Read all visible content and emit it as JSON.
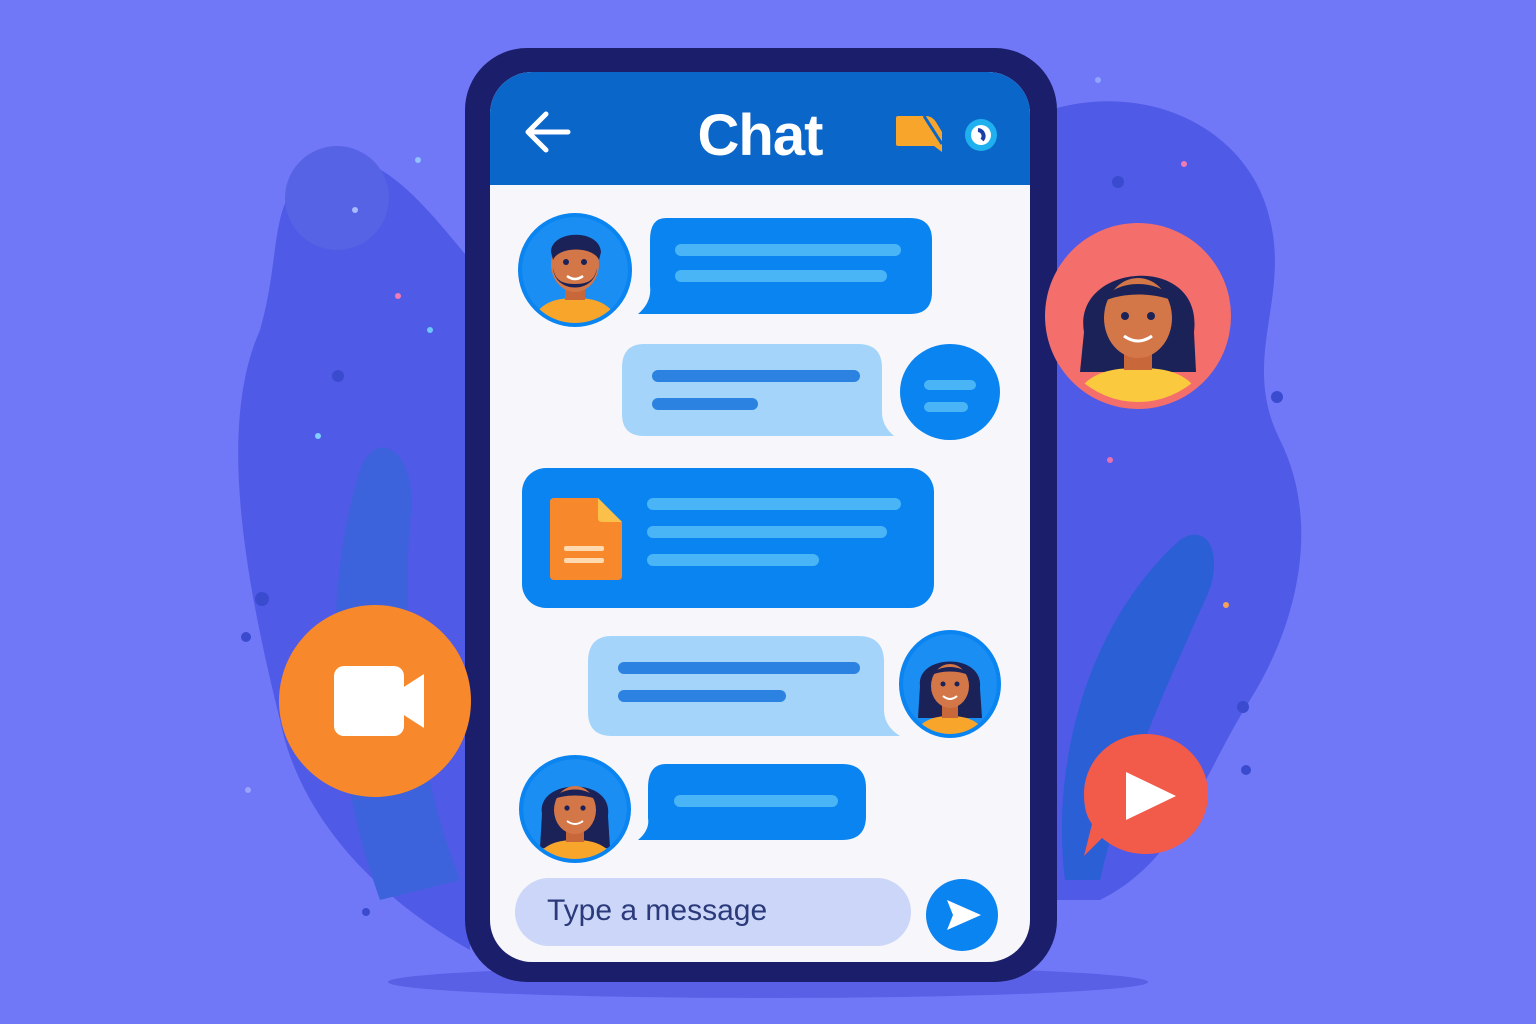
{
  "header": {
    "title": "Chat",
    "back_icon": "arrow-left-icon",
    "note_icon": "note-icon",
    "status_icon": "status-dot-icon"
  },
  "messages": [
    {
      "sender": "man-with-beard",
      "side": "left",
      "style": "dark",
      "lines": 2
    },
    {
      "sender": "me",
      "side": "right",
      "style": "light",
      "lines": 2
    },
    {
      "sender": "attachment",
      "side": "left",
      "style": "dark",
      "lines": 3,
      "icon": "document-icon"
    },
    {
      "sender": "woman",
      "side": "right",
      "style": "light",
      "lines": 2
    },
    {
      "sender": "woman",
      "side": "left",
      "style": "dark",
      "lines": 1
    }
  ],
  "composer": {
    "placeholder": "Type a message",
    "send_icon": "send-icon"
  },
  "floating": {
    "video_call_icon": "video-camera-icon",
    "play_icon": "play-icon",
    "contact_avatar": "woman-avatar"
  },
  "colors": {
    "background": "#7178f7",
    "phone_frame": "#1b1f6b",
    "header": "#0a66c8",
    "bubble_dark": "#0a84f0",
    "bubble_light": "#a4d4fa",
    "accent_orange": "#f7882b",
    "accent_red": "#f25a4a"
  }
}
